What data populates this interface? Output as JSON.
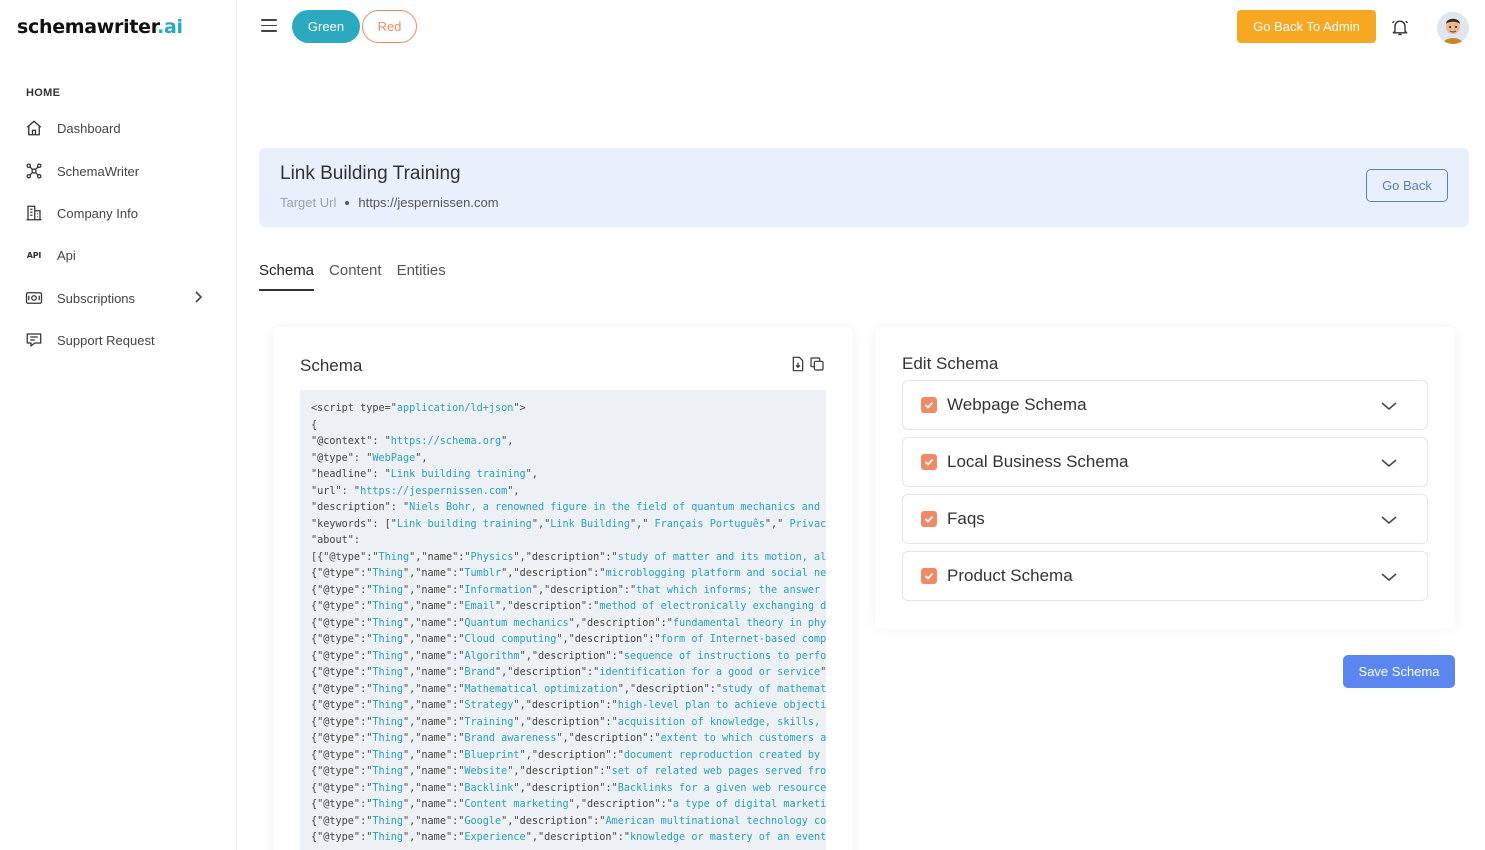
{
  "brand": {
    "name": "schemawriter",
    "suffix": ".ai"
  },
  "sidebar": {
    "section": "HOME",
    "items": [
      {
        "label": "Dashboard",
        "icon": "home-icon"
      },
      {
        "label": "SchemaWriter",
        "icon": "nodes-icon"
      },
      {
        "label": "Company Info",
        "icon": "building-icon"
      },
      {
        "label": "Api",
        "icon": "api-icon"
      },
      {
        "label": "Subscriptions",
        "icon": "money-icon"
      },
      {
        "label": "Support Request",
        "icon": "support-icon"
      }
    ]
  },
  "topbar": {
    "theme_green": "Green",
    "theme_red": "Red",
    "admin_button": "Go Back To Admin"
  },
  "header": {
    "title": "Link Building Training",
    "target_label": "Target Url",
    "target_url": "https://jespernissen.com",
    "go_back": "Go Back"
  },
  "tabs": [
    "Schema",
    "Content",
    "Entities"
  ],
  "schema_panel": {
    "title": "Schema",
    "code_lines": [
      [
        [
          "<script type=\"",
          ""
        ],
        [
          "application/ld+json",
          "s"
        ],
        [
          "\">",
          ""
        ]
      ],
      [
        [
          "{",
          ""
        ]
      ],
      [
        [
          "\"@context\": \"",
          ""
        ],
        [
          "https://schema.org",
          "s"
        ],
        [
          "\",",
          ""
        ]
      ],
      [
        [
          "\"@type\": \"",
          ""
        ],
        [
          "WebPage",
          "s"
        ],
        [
          "\",",
          ""
        ]
      ],
      [
        [
          "\"headline\": \"",
          ""
        ],
        [
          "Link building training",
          "s"
        ],
        [
          "\",",
          ""
        ]
      ],
      [
        [
          "\"url\": \"",
          ""
        ],
        [
          "https://jespernissen.com",
          "s"
        ],
        [
          "\",",
          ""
        ]
      ],
      [
        [
          "\"description\": \"",
          ""
        ],
        [
          "Niels Bohr, a renowned figure in the field of quantum mechanics and p",
          "s"
        ]
      ],
      [
        [
          "\"keywords\": [\"",
          ""
        ],
        [
          "Link building training",
          "s"
        ],
        [
          "\",\"",
          ""
        ],
        [
          "Link Building",
          "s"
        ],
        [
          "\",\" ",
          ""
        ],
        [
          "Français Português",
          "s"
        ],
        [
          "\",\" ",
          ""
        ],
        [
          "Privacy",
          "s"
        ]
      ],
      [
        [
          "\"about\":",
          ""
        ]
      ],
      [
        [
          "[{\"@type\":\"",
          ""
        ],
        [
          "Thing",
          "s"
        ],
        [
          "\",\"name\":\"",
          ""
        ],
        [
          "Physics",
          "s"
        ],
        [
          "\",\"description\":\"",
          ""
        ],
        [
          "study of matter and its motion, alo",
          "s"
        ]
      ],
      [
        [
          "{\"@type\":\"",
          ""
        ],
        [
          "Thing",
          "s"
        ],
        [
          "\",\"name\":\"",
          ""
        ],
        [
          "Tumblr",
          "s"
        ],
        [
          "\",\"description\":\"",
          ""
        ],
        [
          "microblogging platform and social net",
          "s"
        ]
      ],
      [
        [
          "{\"@type\":\"",
          ""
        ],
        [
          "Thing",
          "s"
        ],
        [
          "\",\"name\":\"",
          ""
        ],
        [
          "Information",
          "s"
        ],
        [
          "\",\"description\":\"",
          ""
        ],
        [
          "that which informs; the answer t",
          "s"
        ]
      ],
      [
        [
          "{\"@type\":\"",
          ""
        ],
        [
          "Thing",
          "s"
        ],
        [
          "\",\"name\":\"",
          ""
        ],
        [
          "Email",
          "s"
        ],
        [
          "\",\"description\":\"",
          ""
        ],
        [
          "method of electronically exchanging di",
          "s"
        ]
      ],
      [
        [
          "{\"@type\":\"",
          ""
        ],
        [
          "Thing",
          "s"
        ],
        [
          "\",\"name\":\"",
          ""
        ],
        [
          "Quantum mechanics",
          "s"
        ],
        [
          "\",\"description\":\"",
          ""
        ],
        [
          "fundamental theory in phys",
          "s"
        ]
      ],
      [
        [
          "{\"@type\":\"",
          ""
        ],
        [
          "Thing",
          "s"
        ],
        [
          "\",\"name\":\"",
          ""
        ],
        [
          "Cloud computing",
          "s"
        ],
        [
          "\",\"description\":\"",
          ""
        ],
        [
          "form of Internet-based compu",
          "s"
        ]
      ],
      [
        [
          "{\"@type\":\"",
          ""
        ],
        [
          "Thing",
          "s"
        ],
        [
          "\",\"name\":\"",
          ""
        ],
        [
          "Algorithm",
          "s"
        ],
        [
          "\",\"description\":\"",
          ""
        ],
        [
          "sequence of instructions to perfor",
          "s"
        ]
      ],
      [
        [
          "{\"@type\":\"",
          ""
        ],
        [
          "Thing",
          "s"
        ],
        [
          "\",\"name\":\"",
          ""
        ],
        [
          "Brand",
          "s"
        ],
        [
          "\",\"description\":\"",
          ""
        ],
        [
          "identification for a good or service",
          "s"
        ],
        [
          "\",",
          ""
        ]
      ],
      [
        [
          "{\"@type\":\"",
          ""
        ],
        [
          "Thing",
          "s"
        ],
        [
          "\",\"name\":\"",
          ""
        ],
        [
          "Mathematical optimization",
          "s"
        ],
        [
          "\",\"description\":\"",
          ""
        ],
        [
          "study of mathemati",
          "s"
        ]
      ],
      [
        [
          "{\"@type\":\"",
          ""
        ],
        [
          "Thing",
          "s"
        ],
        [
          "\",\"name\":\"",
          ""
        ],
        [
          "Strategy",
          "s"
        ],
        [
          "\",\"description\":\"",
          ""
        ],
        [
          "high-level plan to achieve objectiv",
          "s"
        ]
      ],
      [
        [
          "{\"@type\":\"",
          ""
        ],
        [
          "Thing",
          "s"
        ],
        [
          "\",\"name\":\"",
          ""
        ],
        [
          "Training",
          "s"
        ],
        [
          "\",\"description\":\"",
          ""
        ],
        [
          "acquisition of knowledge, skills, a",
          "s"
        ]
      ],
      [
        [
          "{\"@type\":\"",
          ""
        ],
        [
          "Thing",
          "s"
        ],
        [
          "\",\"name\":\"",
          ""
        ],
        [
          "Brand awareness",
          "s"
        ],
        [
          "\",\"description\":\"",
          ""
        ],
        [
          "extent to which customers ar",
          "s"
        ]
      ],
      [
        [
          "{\"@type\":\"",
          ""
        ],
        [
          "Thing",
          "s"
        ],
        [
          "\",\"name\":\"",
          ""
        ],
        [
          "Blueprint",
          "s"
        ],
        [
          "\",\"description\":\"",
          ""
        ],
        [
          "document reproduction created by u",
          "s"
        ]
      ],
      [
        [
          "{\"@type\":\"",
          ""
        ],
        [
          "Thing",
          "s"
        ],
        [
          "\",\"name\":\"",
          ""
        ],
        [
          "Website",
          "s"
        ],
        [
          "\",\"description\":\"",
          ""
        ],
        [
          "set of related web pages served from",
          "s"
        ]
      ],
      [
        [
          "{\"@type\":\"",
          ""
        ],
        [
          "Thing",
          "s"
        ],
        [
          "\",\"name\":\"",
          ""
        ],
        [
          "Backlink",
          "s"
        ],
        [
          "\",\"description\":\"",
          ""
        ],
        [
          "Backlinks for a given web resource",
          "s"
        ]
      ],
      [
        [
          "{\"@type\":\"",
          ""
        ],
        [
          "Thing",
          "s"
        ],
        [
          "\",\"name\":\"",
          ""
        ],
        [
          "Content marketing",
          "s"
        ],
        [
          "\",\"description\":\"",
          ""
        ],
        [
          "a type of digital marketin",
          "s"
        ]
      ],
      [
        [
          "{\"@type\":\"",
          ""
        ],
        [
          "Thing",
          "s"
        ],
        [
          "\",\"name\":\"",
          ""
        ],
        [
          "Google",
          "s"
        ],
        [
          "\",\"description\":\"",
          ""
        ],
        [
          "American multinational technology com",
          "s"
        ]
      ],
      [
        [
          "{\"@type\":\"",
          ""
        ],
        [
          "Thing",
          "s"
        ],
        [
          "\",\"name\":\"",
          ""
        ],
        [
          "Experience",
          "s"
        ],
        [
          "\",\"description\":\"",
          ""
        ],
        [
          "knowledge or mastery of an event",
          "s"
        ]
      ]
    ]
  },
  "edit_panel": {
    "title": "Edit Schema",
    "items": [
      "Webpage Schema",
      "Local Business Schema",
      "Faqs",
      "Product Schema"
    ]
  },
  "save_button": "Save Schema",
  "colors": {
    "accent_teal": "#2ba9bf",
    "accent_orange": "#f7a823",
    "checkbox": "#ef8a66",
    "primary_blue": "#5b86f0",
    "header_bg": "#e8f1fb"
  }
}
